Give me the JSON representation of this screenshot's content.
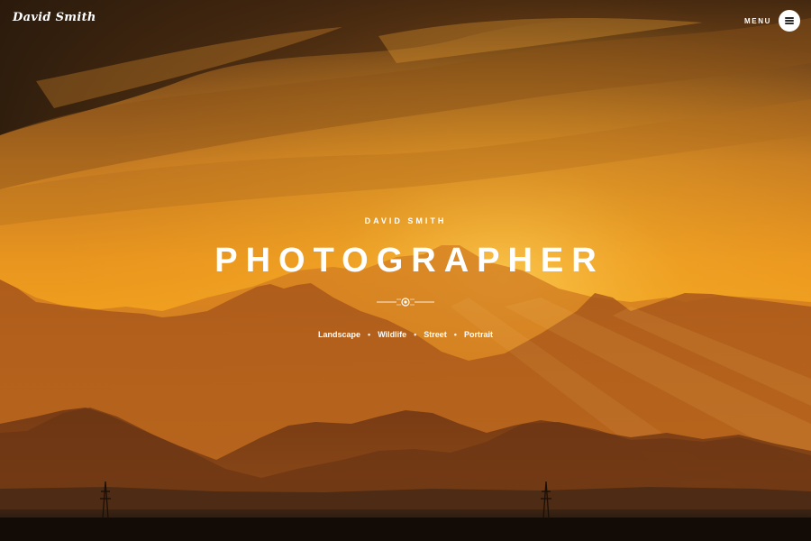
{
  "header": {
    "logo_text": "David Smith",
    "menu_label": "MENU",
    "menu_icon": "hamburger-icon"
  },
  "hero": {
    "subtitle": "DAVID SMITH",
    "title": "PHOTOGRAPHER",
    "divider_icon": "circle-divider-icon",
    "categories": [
      "Landscape",
      "Wildlife",
      "Street",
      "Portrait"
    ],
    "separator": "•",
    "background": "sunset-mountains-photo"
  },
  "colors": {
    "sky_top": "#3a2410",
    "sky_glow": "#f5a21c",
    "mountain_far": "#c8741c",
    "mountain_mid": "#9a4c14",
    "mountain_near": "#5a2c10",
    "ground": "#1e120a",
    "text": "#ffffff"
  }
}
